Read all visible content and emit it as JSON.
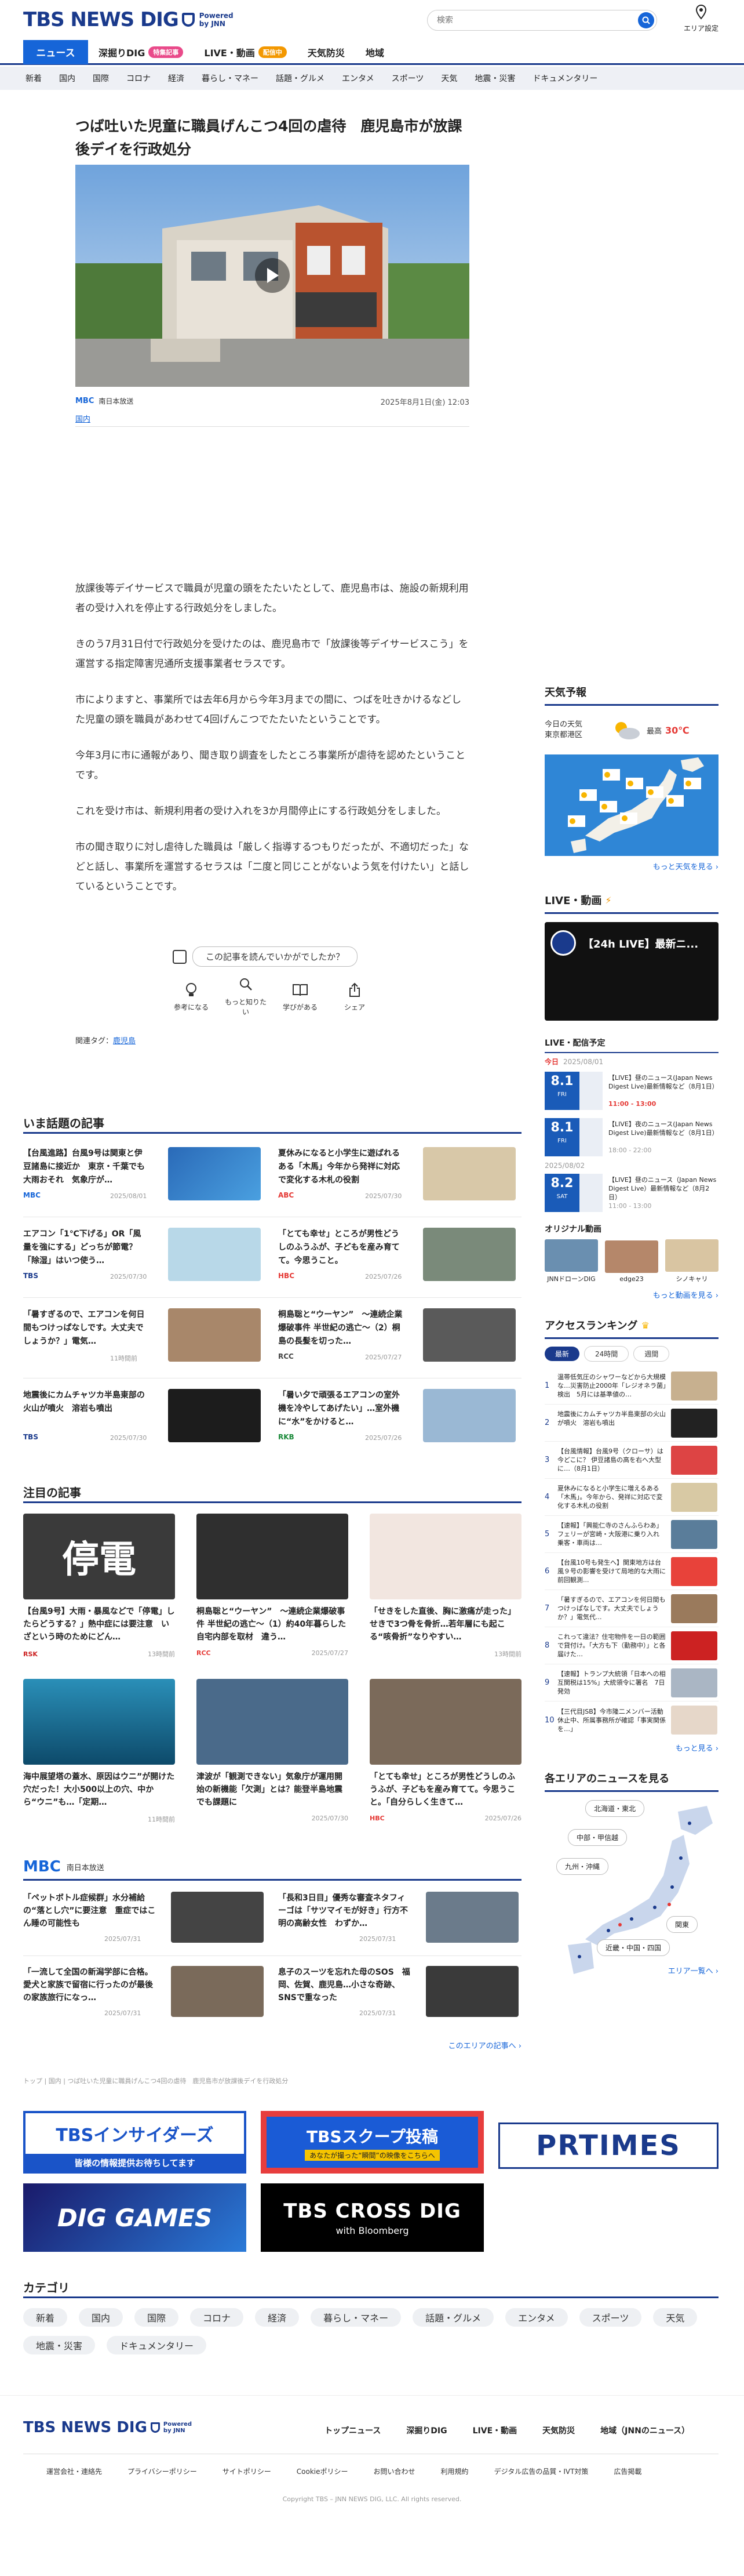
{
  "header": {
    "logo_main": "TBS NEWS DIG",
    "logo_powered": "Powered",
    "logo_by": "by JNN",
    "search_placeholder": "検索",
    "area_label": "エリア設定"
  },
  "topnav": {
    "items": [
      "ニュース",
      "深掘りDIG",
      "LIVE・動画",
      "天気防災",
      "地域"
    ],
    "badge_dig": "特集記事",
    "badge_live": "配信中"
  },
  "catnav": [
    "新着",
    "国内",
    "国際",
    "コロナ",
    "経済",
    "暮らし・マネー",
    "話題・グルメ",
    "エンタメ",
    "スポーツ",
    "天気",
    "地震・災害",
    "ドキュメンタリー"
  ],
  "article": {
    "title": "つば吐いた児童に職員げんこつ4回の虐待　鹿児島市が放課後デイを行政処分",
    "source": "MBC",
    "source_name": "南日本放送",
    "datetime": "2025年8月1日(金) 12:03",
    "category": "国内",
    "paragraphs": [
      "放課後等デイサービスで職員が児童の頭をたたいたとして、鹿児島市は、施設の新規利用者の受け入れを停止する行政処分をしました。",
      "きのう7月31日付で行政処分を受けたのは、鹿児島市で「放課後等デイサービスこう」を運営する指定障害児通所支援事業者セラスです。",
      "市によりますと、事業所では去年6月から今年3月までの間に、つばを吐きかけるなどした児童の頭を職員があわせて4回げんこつでたたいたということです。",
      "今年3月に市に通報があり、聞き取り調査をしたところ事業所が虐待を認めたということです。",
      "これを受け市は、新規利用者の受け入れを3か月間停止にする行政処分をしました。",
      "市の聞き取りに対し虐待した職員は「厳しく指導するつもりだったが、不適切だった」などと話し、事業所を運営するセラスは「二度と同じことがないよう気を付けたい」と話しているということです。"
    ],
    "feedback_question": "この記事を読んでいかがでしたか？",
    "reactions": [
      "参考になる",
      "もっと知りたい",
      "学びがある",
      "シェア"
    ],
    "related_tags_label": "関連タグ：",
    "related_tag": "鹿児島"
  },
  "sidebar": {
    "weather_title": "天気予報",
    "weather_loc1": "今日の天気",
    "weather_loc2": "東京都港区",
    "weather_label": "最高",
    "weather_temp": "30℃",
    "weather_more": "もっと天気を見る",
    "live_title": "LIVE・動画",
    "live_caption": "【24h LIVE】最新ニ...",
    "sched_title": "LIVE・配信予定",
    "sched_date1": "今日",
    "sched_date1b": "2025/08/01",
    "sched_date2": "2025/08/02",
    "schedule": [
      {
        "day": "8.1",
        "dow": "FRI",
        "title": "【LIVE】昼のニュース(Japan News Digest Live)最新情報など（8月1日）",
        "time": "11:00 - 13:00",
        "live": true
      },
      {
        "day": "8.1",
        "dow": "FRI",
        "title": "【LIVE】夜のニュース(Japan News Digest Live)最新情報など（8月1日）",
        "time": "18:00 - 22:00",
        "live": false
      },
      {
        "day": "8.2",
        "dow": "SAT",
        "title": "【LIVE】昼のニュース（Japan News Digest Live）最新情報など（8月2日）",
        "time": "11:00 - 13:00",
        "live": false
      }
    ],
    "original_title": "オリジナル動画",
    "original_items": [
      "JNNドローンDIG",
      "edge23",
      "シノキャリ"
    ],
    "more_video": "もっと動画を見る",
    "ranking_title": "アクセスランキング",
    "ranking_tabs": [
      "最新",
      "24時間",
      "週間"
    ],
    "ranking": [
      "温帯低気圧のシャワーなどから大規模な…災害防止2000年「レジオネラ菌」検出　5月には基準値の…",
      "地震後にカムチャツカ半島東部の火山が噴火　溶岩も噴出",
      "【台風情報】台風9号（クローサ）は今どこに？ 伊豆諸島の高を右へ大型に…（8月1日）",
      "夏休みになると小学生に増えるある「木馬」。今年から、発祥に対応で変化する木札の役割",
      "【速報】「興能仁寺のさんふらわあ」フェリーが宮崎・大阪港に乗り入れ　乗客・車両は…",
      "【台風10号も発生へ】関東地方は台風９号の影響を受けて局地的な大雨に　前回観測...",
      "「暑すぎるので、エアコンを何日間もつけっぱなしです。大丈夫でしょうか？」電気代...",
      "これって違法？住宅物件を一日の範囲で貸付け。「大方も下（勤務中）」と各届けた…",
      "【速報】トランプ大統領「日本への相互関税は15%」大統領令に署名　7日発効",
      "【三代目JSB】今市隆二メンバー活動休止中、所属事務所が確認「事実関係を…」"
    ],
    "ranking_more": "もっと見る",
    "areas_title": "各エリアのニュースを見る",
    "areas": [
      "北海道・東北",
      "中部・甲信越",
      "九州・沖縄",
      "関東",
      "近畿・中国・四国"
    ],
    "areas_more": "エリア一覧へ"
  },
  "hot": {
    "title": "いま話題の記事",
    "items": [
      {
        "title": "【台風進路】台風9号は関東と伊豆諸島に接近か　東京・千葉でも大雨おそれ　気象庁が…",
        "src": "MBC",
        "date": "2025/08/01"
      },
      {
        "title": "夏休みになると小学生に遊ばれるある「木馬」今年から発祥に対応で変化する木札の役割",
        "src": "ABC",
        "date": "2025/07/30"
      },
      {
        "title": "エアコン「1℃下げる」OR「風量を強にする」どっちが節電？「除湿」はいつ使う…",
        "src": "TBS",
        "date": "2025/07/30"
      },
      {
        "title": "「とても幸せ」ところが男性どうしのふうふが、子どもを産み育てて。今思うこと。",
        "src": "HBC",
        "date": "2025/07/26"
      },
      {
        "title": "「暑すぎるので、エアコンを何日間もつけっぱなしです。大丈夫でしょうか？」電気…",
        "src": "",
        "date": "11時間前"
      },
      {
        "title": "桐島聡と“ウーヤン”　〜連続企業爆破事件 半世紀の逃亡〜（2）桐島の長髪を切った…",
        "src": "RCC",
        "date": "2025/07/27"
      },
      {
        "title": "地震後にカムチャツカ半島東部の火山が噴火　溶岩も噴出",
        "src": "TBS",
        "date": "2025/07/30"
      },
      {
        "title": "「暑い夕で頑張るエアコンの室外機を冷やしてあげたい」…室外機に“水”をかけると…",
        "src": "RKB",
        "date": "2025/07/26"
      }
    ]
  },
  "featured": {
    "title": "注目の記事",
    "items": [
      {
        "title": "【台風9号】大雨・暴風などで「停電」したらどうする？」熱中症には要注意　いざという時のためにどん…",
        "src": "RSK",
        "date": "13時間前"
      },
      {
        "title": "桐島聡と“ウーヤン”　〜連続企業爆破事件 半世紀の逃亡〜（1）約40年暮らした自宅内部を取材　違う…",
        "src": "RCC",
        "date": "2025/07/27"
      },
      {
        "title": "「せきをした直後、胸に激痛が走った」せきで3つ骨を骨折…若年層にも起こる“咳骨折”なりやすい…",
        "src": "",
        "date": "13時間前"
      },
      {
        "title": "海中展望塔の蓋水、原因はウニ”が開けた穴だった！大小500以上の穴、中から“ウニ”も…「定期…",
        "src": "",
        "date": "11時間前"
      },
      {
        "title": "津波が「観測できない」気象庁が運用開始の新機能「欠測」とは？能登半島地震でも課題に",
        "src": "",
        "date": "2025/07/30"
      },
      {
        "title": "「とても幸せ」ところが男性どうしのふうふが、子どもを産み育てて。今思うこと。「自分らしく生きて…",
        "src": "HBC",
        "date": "2025/07/26"
      }
    ]
  },
  "local": {
    "logo": "MBC",
    "station": "南日本放送",
    "items": [
      {
        "title": "「ペットボトル症候群」水分補給の“落とし穴”に要注意　重症ではこん睡の可能性も",
        "date": "2025/07/31"
      },
      {
        "title": "「長和3日目」優秀な審査ネタフィーゴは「サツマイモが好き」行方不明の高齢女性　わずか…",
        "date": "2025/07/31"
      },
      {
        "title": "「一流して全国の新潟学部に合格。愛犬と家族で留宿に行ったのが最後の家族旅行になっ…",
        "date": "2025/07/31"
      },
      {
        "title": "息子のスーツを忘れた母のSOS　福岡、佐賀、鹿児島…小さな奇跡、SNSで重なった",
        "date": "2025/07/31"
      }
    ],
    "more": "このエリアの記事へ"
  },
  "breadcrumb": "トップ | 国内 | つば吐いた児童に職員げんこつ4回の虐待　鹿児島市が放課後デイを行政処分",
  "banners": {
    "insiders": "TBSインサイダーズ",
    "insiders_sub": "皆様の情報提供お待ちしてます",
    "scoop": "TBSスクープ投稿",
    "scoop_sub": "あなたが撮った“瞬間”の映像をこちらへ",
    "prtimes": "PRTIMES",
    "games": "DIG GAMES",
    "crossdig": "TBS CROSS DIG",
    "crossdig_sub": "with Bloomberg"
  },
  "categories_title": "カテゴリ",
  "categories": [
    "新着",
    "国内",
    "国際",
    "コロナ",
    "経済",
    "暮らし・マネー",
    "話題・グルメ",
    "エンタメ",
    "スポーツ",
    "天気",
    "地震・災害",
    "ドキュメンタリー"
  ],
  "footer": {
    "nav": [
      "トップニュース",
      "深掘りDIG",
      "LIVE・動画",
      "天気防災",
      "地域（JNNのニュース）"
    ],
    "links": [
      "運営会社・連絡先",
      "プライバシーポリシー",
      "サイトポリシー",
      "Cookieポリシー",
      "お問い合わせ",
      "利用規約",
      "デジタル広告の品質・IVT対策",
      "広告掲載"
    ],
    "copyright": "Copyright TBS – JNN NEWS DIG, LLC. All rights reserved."
  },
  "colors": {
    "navy": "#1a3a8c",
    "blue": "#1665d8",
    "live_red": "#e53935",
    "live_orange": "#f39800"
  }
}
